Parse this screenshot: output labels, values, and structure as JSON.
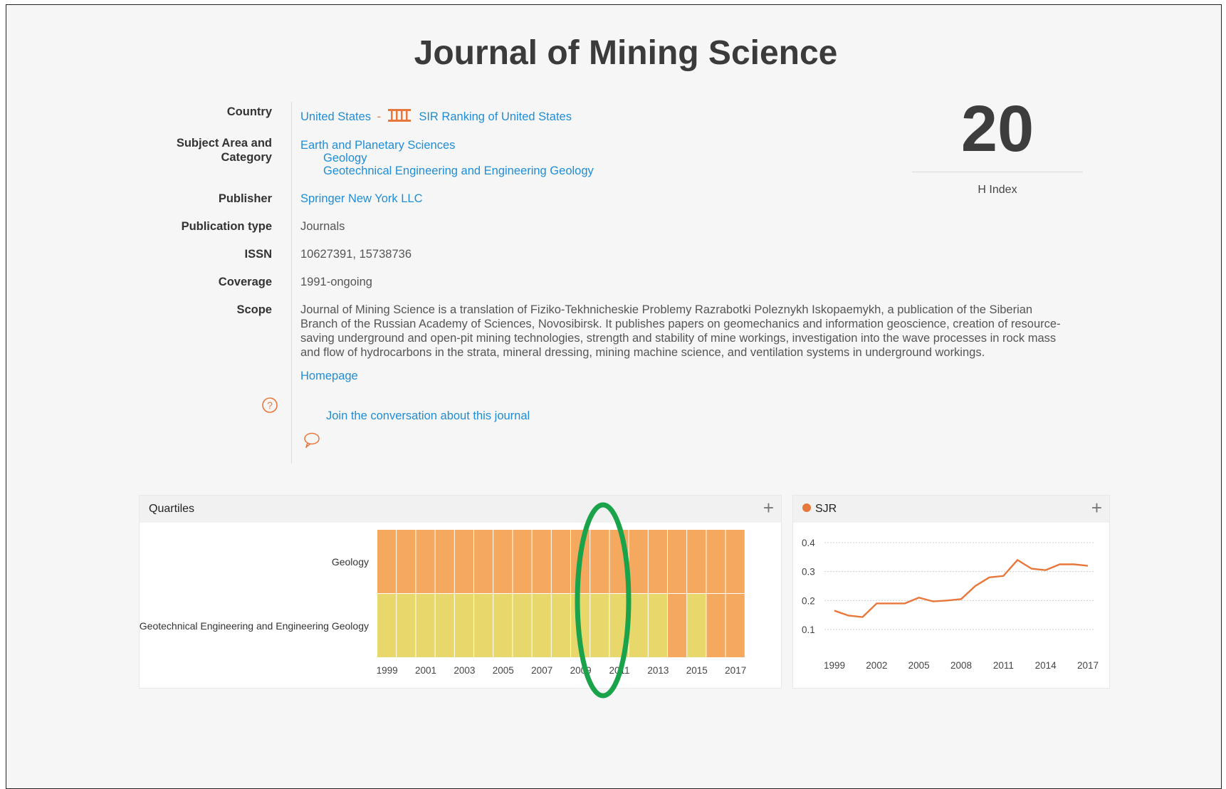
{
  "page_title": "Journal of Mining Science",
  "labels": {
    "country": "Country",
    "subject": "Subject Area and Category",
    "publisher": "Publisher",
    "pubtype": "Publication type",
    "issn": "ISSN",
    "coverage": "Coverage",
    "scope": "Scope"
  },
  "country": {
    "name": "United States",
    "separator": "-",
    "sir_link": "SIR Ranking of United States"
  },
  "subject": {
    "area": "Earth and Planetary Sciences",
    "categories": [
      "Geology",
      "Geotechnical Engineering and Engineering Geology"
    ]
  },
  "publisher": "Springer New York LLC",
  "publication_type": "Journals",
  "issn": "10627391, 15738736",
  "coverage": "1991-ongoing",
  "scope": "Journal of Mining Science is a translation of Fiziko-Tekhnicheskie Problemy Razrabotki Poleznykh Iskopaemykh, a publication of the Siberian Branch of the Russian Academy of Sciences, Novosibirsk. It publishes papers on geomechanics and information geoscience, creation of resource-saving underground and open-pit mining technologies, strength and stability of mine workings, investigation into the wave processes in rock mass and flow of hydrocarbons in the strata, mineral dressing, mining machine science, and ventilation systems in underground workings.",
  "homepage_label": "Homepage",
  "conversation_label": "Join the conversation about this journal",
  "h_index": {
    "value": "20",
    "label": "H Index"
  },
  "colors": {
    "link": "#1f8dd6",
    "accent": "#e8773b",
    "q1": "#e8d86b",
    "q2": "#f5a95f",
    "highlight": "#1aa34a"
  },
  "icons": {
    "sir": "building-columns-icon",
    "help": "question-circle-icon",
    "comment": "speech-bubble-icon",
    "expand": "plus-icon"
  },
  "quartiles": {
    "title": "Quartiles",
    "plus": "+"
  },
  "sjr": {
    "title": "SJR",
    "plus": "+"
  },
  "chart_data": [
    {
      "type": "heatmap",
      "title": "Quartiles",
      "categories": [
        "Geology",
        "Geotechnical Engineering and Engineering Geology"
      ],
      "years": [
        1999,
        2000,
        2001,
        2002,
        2003,
        2004,
        2005,
        2006,
        2007,
        2008,
        2009,
        2010,
        2011,
        2012,
        2013,
        2014,
        2015,
        2016,
        2017
      ],
      "tick_labels": [
        "1999",
        "2001",
        "2003",
        "2005",
        "2007",
        "2009",
        "2011",
        "2013",
        "2015",
        "2017"
      ],
      "quartiles": {
        "Geology": [
          "Q3",
          "Q3",
          "Q3",
          "Q3",
          "Q3",
          "Q3",
          "Q3",
          "Q3",
          "Q3",
          "Q3",
          "Q3",
          "Q3",
          "Q3",
          "Q3",
          "Q3",
          "Q3",
          "Q3",
          "Q3",
          "Q3"
        ],
        "Geotechnical Engineering and Engineering Geology": [
          "Q2",
          "Q2",
          "Q2",
          "Q2",
          "Q2",
          "Q2",
          "Q2",
          "Q2",
          "Q2",
          "Q2",
          "Q2",
          "Q2",
          "Q2",
          "Q2",
          "Q2",
          "Q3",
          "Q2",
          "Q3",
          "Q3"
        ]
      },
      "highlighted_year": "2009"
    },
    {
      "type": "line",
      "title": "SJR",
      "x": [
        1999,
        2000,
        2001,
        2002,
        2003,
        2004,
        2005,
        2006,
        2007,
        2008,
        2009,
        2010,
        2011,
        2012,
        2013,
        2014,
        2015,
        2016,
        2017
      ],
      "values": [
        0.165,
        0.148,
        0.143,
        0.19,
        0.19,
        0.19,
        0.21,
        0.197,
        0.2,
        0.205,
        0.25,
        0.28,
        0.285,
        0.34,
        0.31,
        0.305,
        0.325,
        0.325,
        0.32
      ],
      "xticks": [
        "1999",
        "2002",
        "2005",
        "2008",
        "2011",
        "2014",
        "2017"
      ],
      "yticks": [
        "0.4",
        "0.3",
        "0.2",
        "0.1"
      ],
      "ylim": [
        0.1,
        0.4
      ],
      "grid": true
    }
  ]
}
